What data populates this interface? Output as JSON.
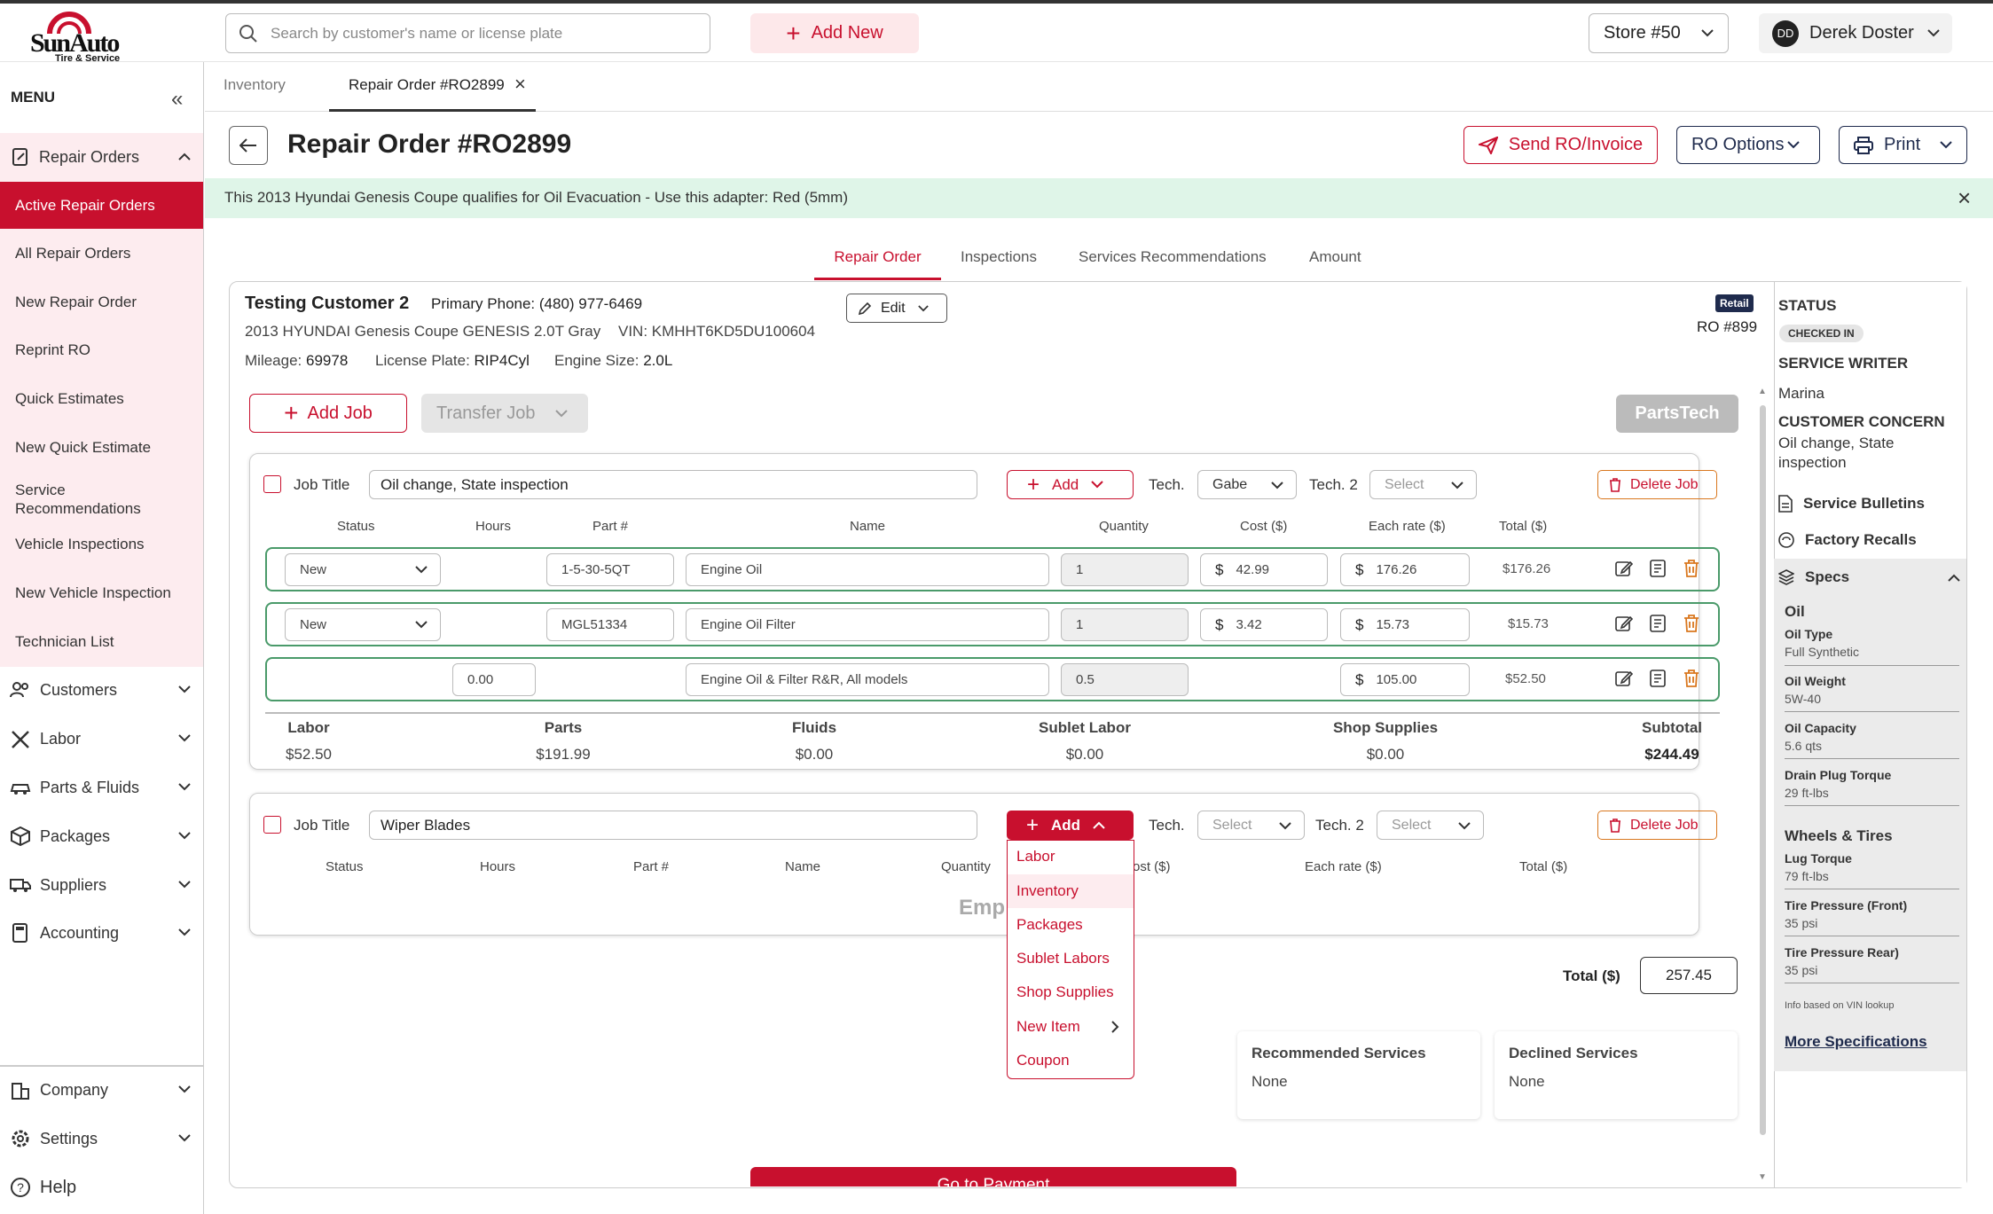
{
  "app": {
    "logo_main": "SunAuto",
    "logo_sub": "Tire & Service"
  },
  "header": {
    "search_placeholder": "Search by customer's name or license plate",
    "add_new": "Add New",
    "store": "Store #50",
    "user_initials": "DD",
    "user_name": "Derek Doster"
  },
  "sidebar": {
    "menu_label": "MENU",
    "repair_orders": "Repair Orders",
    "sub": [
      "Active Repair Orders",
      "All Repair Orders",
      "New Repair Order",
      "Reprint RO",
      "Quick Estimates",
      "New Quick Estimate",
      "Service Recommendations",
      "Vehicle Inspections",
      "New Vehicle Inspection",
      "Technician List"
    ],
    "groups": [
      "Customers",
      "Labor",
      "Parts & Fluids",
      "Packages",
      "Suppliers",
      "Accounting"
    ],
    "bottom": [
      "Company",
      "Settings"
    ],
    "help": "Help"
  },
  "tabs": [
    "Inventory",
    "Repair Order #RO2899"
  ],
  "page": {
    "title": "Repair Order #RO2899",
    "send": "Send RO/Invoice",
    "options": "RO Options",
    "print": "Print",
    "banner": "This 2013 Hyundai Genesis Coupe qualifies for Oil Evacuation - Use this adapter: Red (5mm)"
  },
  "subtabs": [
    "Repair Order",
    "Inspections",
    "Services Recommendations",
    "Amount"
  ],
  "customer": {
    "name": "Testing Customer 2",
    "phone": "Primary Phone: (480) 977-6469",
    "vehicle": "2013 HYUNDAI Genesis Coupe GENESIS 2.0T Gray",
    "vin": "VIN: KMHHT6KD5DU100604",
    "mileage_label": "Mileage:",
    "mileage": "69978",
    "plate_label": "License Plate:",
    "plate": "RIP4Cyl",
    "engine_label": "Engine Size:",
    "engine": "2.0L",
    "edit": "Edit",
    "badge": "Retail",
    "ro_num": "RO #899"
  },
  "actions": {
    "add_job": "Add Job",
    "transfer_job": "Transfer Job",
    "partstech": "PartsTech"
  },
  "columns": [
    "Status",
    "Hours",
    "Part #",
    "Name",
    "Quantity",
    "Cost ($)",
    "Each rate ($)",
    "Total ($)"
  ],
  "job1": {
    "title_label": "Job Title",
    "title": "Oil change,  State inspection",
    "add": "Add",
    "tech_label": "Tech.",
    "tech": "Gabe",
    "tech2_label": "Tech. 2",
    "tech2": "Select",
    "delete": "Delete Job",
    "rows": [
      {
        "status": "New",
        "hours": "",
        "part": "1-5-30-5QT",
        "name": "Engine Oil",
        "qty": "1",
        "cost": "42.99",
        "rate": "176.26",
        "total": "$176.26"
      },
      {
        "status": "New",
        "hours": "",
        "part": "MGL51334",
        "name": "Engine Oil Filter",
        "qty": "1",
        "cost": "3.42",
        "rate": "15.73",
        "total": "$15.73"
      },
      {
        "status": "",
        "hours": "0.00",
        "part": "",
        "name": "Engine Oil & Filter R&R, All models",
        "qty": "0.5",
        "cost": "",
        "rate": "105.00",
        "total": "$52.50"
      }
    ],
    "summary": [
      {
        "k": "Labor",
        "v": "$52.50"
      },
      {
        "k": "Parts",
        "v": "$191.99"
      },
      {
        "k": "Fluids",
        "v": "$0.00"
      },
      {
        "k": "Sublet Labor",
        "v": "$0.00"
      },
      {
        "k": "Shop Supplies",
        "v": "$0.00"
      },
      {
        "k": "Subtotal",
        "v": "$244.49"
      }
    ]
  },
  "job2": {
    "title_label": "Job Title",
    "title": "Wiper Blades",
    "add": "Add",
    "tech_label": "Tech.",
    "tech": "Select",
    "tech2_label": "Tech. 2",
    "tech2": "Select",
    "delete": "Delete Job",
    "cols": [
      "Status",
      "Hours",
      "Part #",
      "Name",
      "Quantity",
      "ost ($)",
      "Each rate ($)",
      "Total ($)"
    ],
    "empty": "Emp"
  },
  "dropdown": [
    "Labor",
    "Inventory",
    "Packages",
    "Sublet Labors",
    "Shop Supplies",
    "New Item",
    "Coupon"
  ],
  "totals": {
    "label": "Total ($)",
    "value": "257.45"
  },
  "recommended": {
    "title": "Recommended Services",
    "value": "None"
  },
  "declined": {
    "title": "Declined Services",
    "value": "None"
  },
  "payment": "Go to Payment",
  "status_panel": {
    "status_label": "STATUS",
    "status": "CHECKED IN",
    "writer_label": "SERVICE WRITER",
    "writer": "Marina",
    "concern_label": "CUSTOMER CONCERN",
    "concern": "Oil change, State inspection",
    "bulletins": "Service Bulletins",
    "recalls": "Factory Recalls",
    "specs": "Specs",
    "oil_title": "Oil",
    "oil": [
      {
        "k": "Oil Type",
        "v": "Full Synthetic"
      },
      {
        "k": "Oil Weight",
        "v": "5W-40"
      },
      {
        "k": "Oil Capacity",
        "v": "5.6 qts"
      },
      {
        "k": "Drain Plug Torque",
        "v": "29 ft-lbs"
      }
    ],
    "wheels_title": "Wheels & Tires",
    "wheels": [
      {
        "k": "Lug Torque",
        "v": "79 ft-lbs"
      },
      {
        "k": "Tire Pressure (Front)",
        "v": "35 psi"
      },
      {
        "k": "Tire Pressure Rear)",
        "v": "35 psi"
      }
    ],
    "note": "Info based on VIN lookup",
    "more": "More Specifications"
  },
  "colors": {
    "accent": "#c8102e",
    "banner": "#dff5e8",
    "row_border": "#4a9a6a"
  }
}
